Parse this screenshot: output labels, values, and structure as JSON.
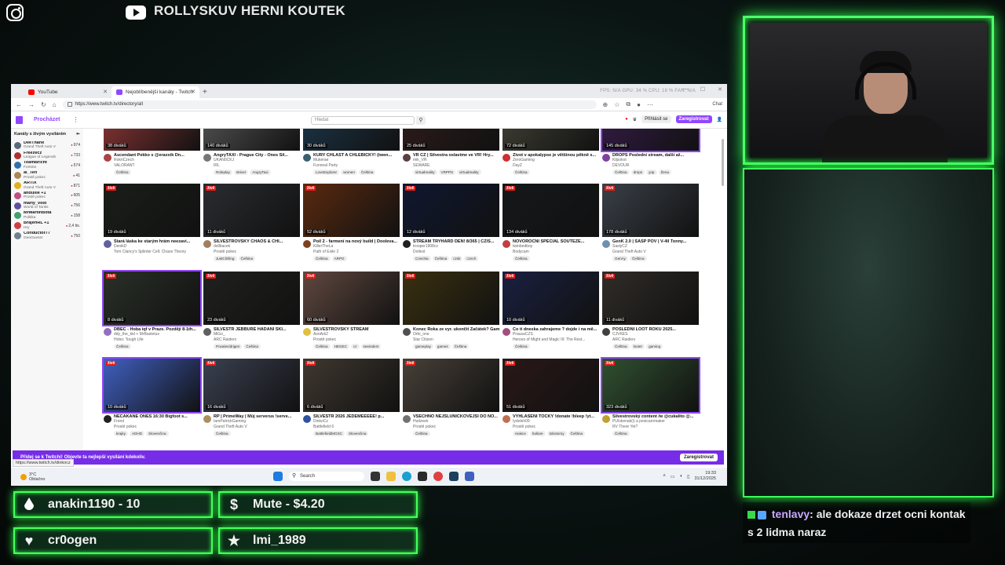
{
  "overlay": {
    "stream_title": "ROLLYSKUV HERNI KOUTEK",
    "alerts": [
      {
        "icon": "drop-icon",
        "text": "anakin1190 - 10"
      },
      {
        "icon": "dollar-icon",
        "text": "Mute - $4.20"
      },
      {
        "icon": "heart-icon",
        "text": "cr0ogen"
      },
      {
        "icon": "star-icon",
        "text": "lmi_1989"
      }
    ],
    "chat": {
      "user": "tenlavy",
      "message": ": ale dokaze drzet ocni kontak s 2 lidma naraz"
    }
  },
  "browser": {
    "tabs": [
      {
        "label": "YouTube",
        "icon_color": "#ff0000"
      },
      {
        "label": "Nejoblíbenější kanály - Twitch",
        "icon_color": "#9147ff"
      }
    ],
    "url": "https://www.twitch.tv/directory/all",
    "sys_stats": "FPS: N/A   GPU: 34 %   CPU: 18 %   FAN: N/A",
    "chat_btn": "Chat",
    "status_url": "https://www.twitch.tv/dinkocz"
  },
  "twitch": {
    "browse": "Procházet",
    "search_placeholder": "Hledat",
    "login": "Přihlásit se",
    "signup": "Zaregistrovat",
    "sidebar_title": "Kanály s živým vysíláním",
    "sidebar": [
      {
        "name": "DeeThane",
        "game": "Grand Theft Auto V",
        "viewers": "974",
        "color": "#5a6b7c"
      },
      {
        "name": "Freezecz",
        "game": "League of Legends",
        "viewers": "733",
        "color": "#b03030"
      },
      {
        "name": "TeamBricht",
        "game": "Fortnite",
        "viewers": "574",
        "color": "#3070b0"
      },
      {
        "name": "al_Teri",
        "game": "Prostě pokec",
        "viewers": "41",
        "color": "#aa8855"
      },
      {
        "name": "ARTIX",
        "game": "Grand Theft Auto V",
        "viewers": "871",
        "color": "#e0b020"
      },
      {
        "name": "andullie +1",
        "game": "Prostě pokec",
        "viewers": "605",
        "color": "#c05080"
      },
      {
        "name": "marty_volo",
        "game": "World of Tanks",
        "viewers": "756",
        "color": "#6050a0"
      },
      {
        "name": "MrMartinBota",
        "game": "Politika",
        "viewers": "158",
        "color": "#40a070"
      },
      {
        "name": "BrajeriRL +1",
        "game": "Hry",
        "viewers": "2,4 tis.",
        "color": "#d04040"
      },
      {
        "name": "Conductor77",
        "game": "GeoGuessr",
        "viewers": "750",
        "color": "#708090"
      }
    ],
    "rows": [
      {
        "short": true,
        "cards": [
          {
            "viewers": "38 diváků",
            "title": "Ascendant Pekko s @eraxxik Dn...",
            "name": "RoknCzech",
            "game": "VALORANT",
            "tags": [
              "Čeština"
            ],
            "bg": "#7a3030",
            "av": "#aa4444"
          },
          {
            "viewers": "140 diváků",
            "title": "AngryTAXI - Prague City - Ones Sil...",
            "name": "UKAN0CKJ",
            "game": "IRL",
            "tags": [
              "Roleplay",
              "striver",
              "AngryTaxi"
            ],
            "bg": "#4a4a4a",
            "av": "#777"
          },
          {
            "viewers": "30 diváků",
            "title": "KURY CHLAST A CHLEBÍČKY! (twen...",
            "name": "Mukerae",
            "game": "Funneal Party",
            "tags": [
              "LoveExplorer",
              "women",
              "Čeština"
            ],
            "bg": "#1a3040",
            "av": "#3a6070"
          },
          {
            "viewers": "25 diváků",
            "title": "VR CZ | Silvestra oslavíme ve VR! Hry...",
            "name": "mik_VR",
            "game": "SEWARE",
            "tags": [
              "virtualreality",
              "VRPPS",
              "virtualreality"
            ],
            "bg": "#2a1a1a",
            "av": "#5a4040"
          },
          {
            "viewers": "72 diváků",
            "title": "Život v apokalypse je většinou pěkně s...",
            "name": "ZeroGaming",
            "game": "DayZ",
            "tags": [
              "Čeština"
            ],
            "bg": "#3a3a30",
            "av": "#cc3030"
          },
          {
            "viewers": "145 diváků",
            "title": "DROPS Poslední stream, další až...",
            "name": "Kilpokot",
            "game": "DEVOUR",
            "tags": [
              "Čeština",
              "drops",
              "yop",
              "Žena"
            ],
            "bg": "#301a40",
            "av": "#8040a0"
          }
        ]
      },
      {
        "short": false,
        "cards": [
          {
            "viewers": "19 diváků",
            "title": "Stará láska ke starým hrám neezavi...",
            "name": "DenikD",
            "game": "Tom Clancy's Splinter Cell: Chaos Theory",
            "tags": [],
            "bg": "#1a1e1a",
            "av": "#6060a0"
          },
          {
            "viewers": "11 diváků",
            "title": "SILVESTROVSKÝ CHAOS & CHI...",
            "name": "dollbacek",
            "game": "Prostě pokec",
            "tags": [
              "JustChilling",
              "Čeština"
            ],
            "bg": "#2a2c30",
            "av": "#a08060"
          },
          {
            "viewers": "52 diváků",
            "title": "Poil 2 - farmení na nový build | Dooleva...",
            "name": "KillerTheLa",
            "game": "Path of Exile 2",
            "tags": [
              "Čeština",
              "ARPG"
            ],
            "bg": "#5a2a10",
            "av": "#804020"
          },
          {
            "viewers": "12 diváků",
            "title": "STREAM TRYHARD DEN! 8/365 | CZ/S...",
            "name": "trooper1908cz",
            "game": "Dotlext",
            "tags": [
              "Czechia",
              "Čeština",
              "czsk",
              "czech"
            ],
            "bg": "#101830",
            "av": "#202020"
          },
          {
            "viewers": "134 diváků",
            "title": "NOVOROČNÍ SPECIÁL SOUTĚŽE...",
            "name": "twinbedboy",
            "game": "Bodycam",
            "tags": [
              "Čeština"
            ],
            "bg": "#15181a",
            "av": "#c04040"
          },
          {
            "viewers": "178 diváků",
            "title": "GenK 2.0 | SASP POV | V-4ll Tonny...",
            "name": "SaslyCZ",
            "game": "Grand Theft Auto V",
            "tags": [
              "GenAy",
              "Čeština"
            ],
            "bg": "#3a4048",
            "av": "#7090b0"
          }
        ]
      },
      {
        "short": false,
        "cards": [
          {
            "viewers": "8 diváků",
            "title": "DBEC - Hoba iqf v Praze. Pozdějí 8-1th...",
            "name": "ddy_the_kid + MrBastetus",
            "game": "Hobo: Tough Life",
            "tags": [
              "Čeština"
            ],
            "bg": "#2a3028",
            "av": "#9070c0"
          },
          {
            "viewers": "23 diváků",
            "title": "SILVESTR JEBBURE HÁDÁNÍ SKI...",
            "name": "MiGo_",
            "game": "ARC Raiders",
            "tags": [
              "Povalevídrigen",
              "Čeština"
            ],
            "bg": "#20201e",
            "av": "#606060"
          },
          {
            "viewers": "60 diváků",
            "title": "SILVESTROVSKÝ STREAM",
            "name": "AsnArk2",
            "game": "Prostě pokec",
            "tags": [
              "Čeština",
              "HEGEC",
              "cz",
              "seeinders"
            ],
            "bg": "#604840",
            "av": "#e0c040"
          },
          {
            "viewers": "",
            "title": "Konec Roka ze vyr. ukončit Začátek? Game...",
            "name": "Orbi_one",
            "game": "Star Citizen",
            "tags": [
              "gameplay",
              "games",
              "Čeština"
            ],
            "bg": "#3a3010",
            "av": "#505050"
          },
          {
            "viewers": "10 diváků",
            "title": "Co ti dneska zahrajeme ? dojde i na mě...",
            "name": "PrausaCZS",
            "game": "Heroes of Might and Magic III: The Rest...",
            "tags": [
              "Čeština"
            ],
            "bg": "#1a2040",
            "av": "#a05080"
          },
          {
            "viewers": "11 diváků",
            "title": "POSLEDNÍ LOOT ROKU 2025...",
            "name": "CJVKES",
            "game": "ARC Raiders",
            "tags": [
              "Čeština",
              "looter",
              "gaming"
            ],
            "bg": "#302c28",
            "av": "#404040"
          }
        ]
      },
      {
        "short": false,
        "cards": [
          {
            "viewers": "10 diváků",
            "title": "NECAKANE ONES 16:30 Bigfoot s...",
            "name": "Frend",
            "game": "Prostě pokec",
            "tags": [
              "krajky",
              "ADHD",
              "Slovenčina"
            ],
            "bg": "#4060c0",
            "av": "#202020"
          },
          {
            "viewers": "16 diváků",
            "title": "RP | PrimeWay | Můj serverus !serve...",
            "name": "IamPatrickGaming",
            "game": "Grand Theft Auto V",
            "tags": [
              "Čeština"
            ],
            "bg": "#3a4050",
            "av": "#aa9060"
          },
          {
            "viewers": "6 diváků",
            "title": "SILVESTR 2026 JEDEMEEEEE! p...",
            "name": "DinkoCz",
            "game": "Battlefield 6",
            "tags": [
              "BattlefieldMGSC",
              "Slovenčina"
            ],
            "bg": "#403830",
            "av": "#3050a0"
          },
          {
            "viewers": "",
            "title": "VŠECHNO NEJSLUNÍČKOVĚJŠÍ DO NO...",
            "name": "Hutlzeek",
            "game": "Prostě pokec",
            "tags": [
              "Čeština"
            ],
            "bg": "#484038",
            "av": "#707070"
          },
          {
            "viewers": "51 diváků",
            "title": "VYHLÁŠENÍ TOČKY !donate !bleep !yt...",
            "name": "Iydoleh09",
            "game": "Prostě pokec",
            "tags": [
              "reakce",
              "hallure",
              "tobotomy",
              "Čeština"
            ],
            "bg": "#2a1818",
            "av": "#c07050"
          },
          {
            "viewers": "323 diváků",
            "title": "Silvestrovský content /w @cukalito @...",
            "name": "PUIskenak(i) a pesicarnmaker",
            "game": "RV There Yet?",
            "tags": [
              "Čeština"
            ],
            "bg": "#305030",
            "av": "#c0a030"
          }
        ]
      }
    ],
    "banner_text": "Přidej se k Twitchi! Objevte ta nejlepší vysílání kdekoliv.",
    "banner_btn": "Zaregistrovat"
  },
  "taskbar": {
    "weather_temp": "3°C",
    "weather_desc": "Oblačno",
    "search": "Search",
    "time": "19:33",
    "date": "31/12/2025"
  }
}
